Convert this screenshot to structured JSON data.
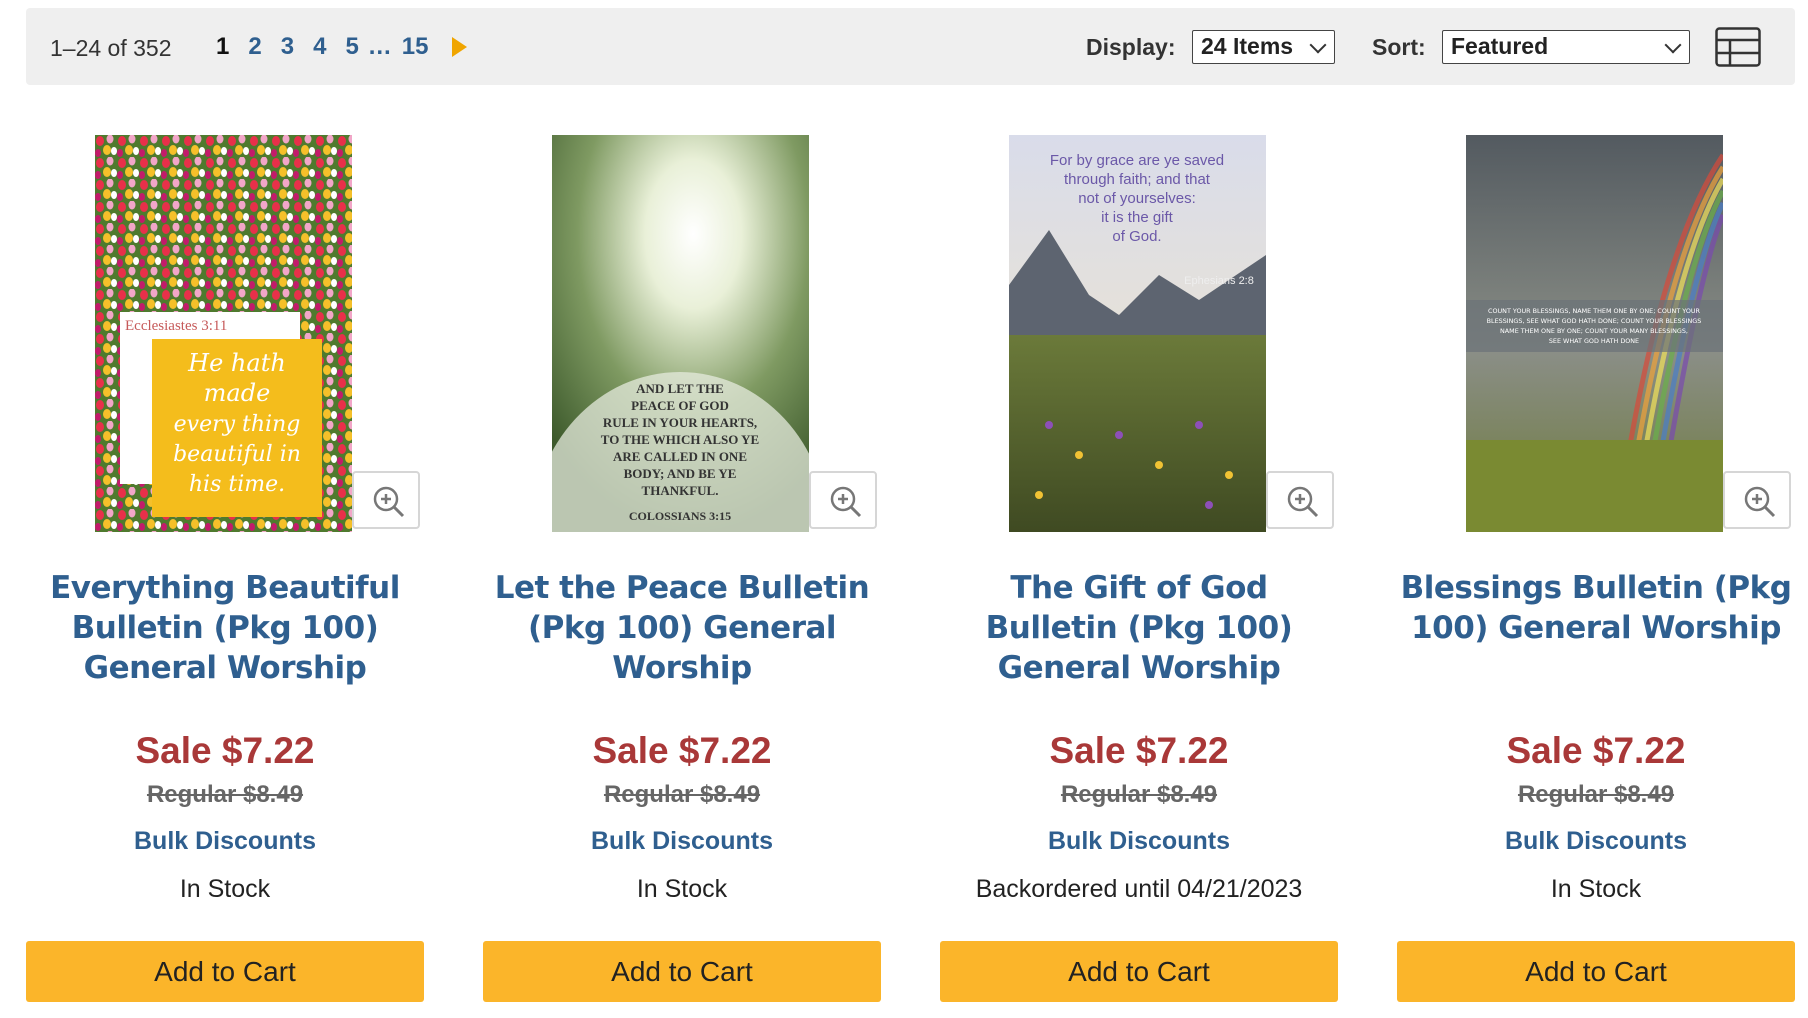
{
  "toolbar": {
    "result_count": "1–24 of 352",
    "pages": [
      "1",
      "2",
      "3",
      "4",
      "5"
    ],
    "ellipsis": "…",
    "last_page": "15",
    "display_label": "Display:",
    "display_value": "24 Items",
    "sort_label": "Sort:",
    "sort_value": "Featured"
  },
  "products": [
    {
      "title": "Everything Beautiful Bulletin (Pkg 100) General Worship",
      "sale": "Sale $7.22",
      "regular": "Regular $8.49",
      "bulk": "Bulk Discounts",
      "stock": "In Stock",
      "cart": "Add to Cart",
      "image_text": {
        "ref": "Ecclesiastes 3:11",
        "line1": "He hath",
        "line2": "made",
        "line3": "every thing",
        "line4": "beautiful in",
        "line5": "his time."
      }
    },
    {
      "title": "Let the Peace Bulletin (Pkg 100) General Worship",
      "sale": "Sale $7.22",
      "regular": "Regular $8.49",
      "bulk": "Bulk Discounts",
      "stock": "In Stock",
      "cart": "Add to Cart",
      "image_text": {
        "line1": "AND LET THE",
        "line2": "PEACE OF GOD",
        "line3": "RULE IN YOUR HEARTS,",
        "line4": "TO THE WHICH ALSO YE",
        "line5": "ARE CALLED IN ONE",
        "line6": "BODY; AND BE YE",
        "line7": "THANKFUL.",
        "ref": "COLOSSIANS 3:15"
      }
    },
    {
      "title": "The Gift of God Bulletin (Pkg 100) General Worship",
      "sale": "Sale $7.22",
      "regular": "Regular $8.49",
      "bulk": "Bulk Discounts",
      "stock": "Backordered until 04/21/2023",
      "cart": "Add to Cart",
      "image_text": {
        "line1": "For by grace are ye saved",
        "line2": "through faith; and that",
        "line3": "not of yourselves:",
        "line4": "it is the gift",
        "line5": "of God.",
        "ref": "Ephesians 2:8"
      }
    },
    {
      "title": "Blessings Bulletin (Pkg 100) General Worship",
      "sale": "Sale $7.22",
      "regular": "Regular $8.49",
      "bulk": "Bulk Discounts",
      "stock": "In Stock",
      "cart": "Add to Cart",
      "image_text": {
        "line1": "COUNT YOUR BLESSINGS, NAME THEM ONE BY ONE; COUNT YOUR",
        "line2": "BLESSINGS, SEE WHAT GOD HATH DONE; COUNT YOUR BLESSINGS",
        "line3": "NAME THEM ONE BY ONE; COUNT YOUR MANY BLESSINGS,",
        "line4": "SEE WHAT GOD HATH DONE"
      }
    }
  ],
  "icons": {
    "zoom": "zoom-in-icon",
    "next": "next-page-icon",
    "grid": "grid-view-icon"
  },
  "colors": {
    "link": "#2f5f8f",
    "sale": "#a93838",
    "cart_button": "#fbb52a",
    "pager_arrow": "#f0a500",
    "toolbar_bg": "#efefef"
  }
}
